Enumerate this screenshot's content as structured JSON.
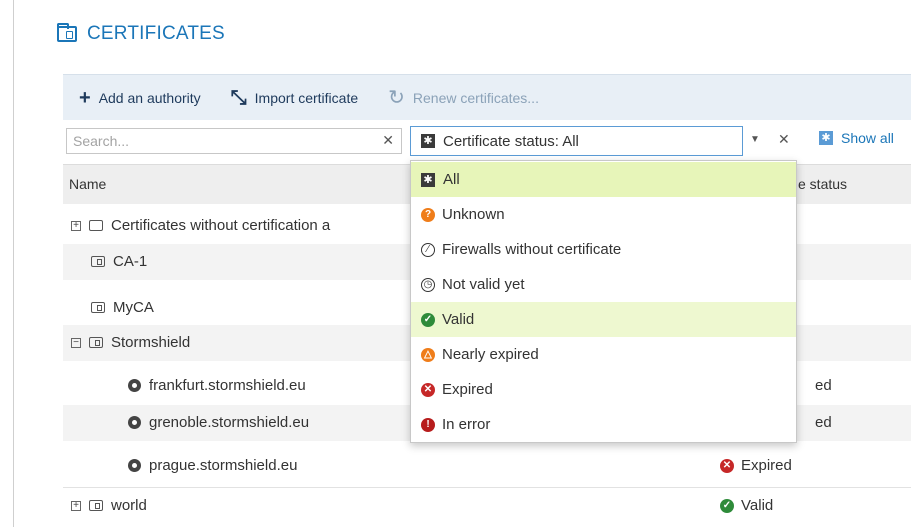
{
  "page": {
    "title": "CERTIFICATES"
  },
  "toolbar": {
    "add_authority": "Add an authority",
    "import_certificate": "Import certificate",
    "renew_certificates": "Renew certificates..."
  },
  "filter": {
    "search_placeholder": "Search...",
    "status_prefix": "Certificate status: All",
    "show_all": "Show all"
  },
  "grid": {
    "col_name": "Name",
    "col_status_visible": "e status",
    "rows": [
      {
        "name": "Certificates without certification a",
        "status": ""
      },
      {
        "name": "CA-1",
        "status": ""
      },
      {
        "name": "MyCA",
        "status": ""
      },
      {
        "name": "Stormshield",
        "status": ""
      },
      {
        "name": "frankfurt.stormshield.eu",
        "status": "ed"
      },
      {
        "name": "grenoble.stormshield.eu",
        "status": "ed"
      },
      {
        "name": "prague.stormshield.eu",
        "status": "Expired"
      },
      {
        "name": "world",
        "status": "Valid"
      }
    ]
  },
  "dropdown": {
    "items": [
      {
        "label": "All",
        "icon": "all-icon"
      },
      {
        "label": "Unknown",
        "icon": "unknown-icon"
      },
      {
        "label": "Firewalls without certificate",
        "icon": "no-certificate-icon"
      },
      {
        "label": "Not valid yet",
        "icon": "clock-icon"
      },
      {
        "label": "Valid",
        "icon": "valid-icon"
      },
      {
        "label": "Nearly expired",
        "icon": "warning-icon"
      },
      {
        "label": "Expired",
        "icon": "expired-icon"
      },
      {
        "label": "In error",
        "icon": "error-icon"
      }
    ]
  },
  "colors": {
    "accent": "#1b76b8",
    "toolbar_bg": "#e8eff6",
    "highlight": "#e7f5b9",
    "expired": "#c62828",
    "valid": "#2e8b3a",
    "nearly_expired": "#ef7d1a",
    "unknown": "#ef7d1a"
  }
}
